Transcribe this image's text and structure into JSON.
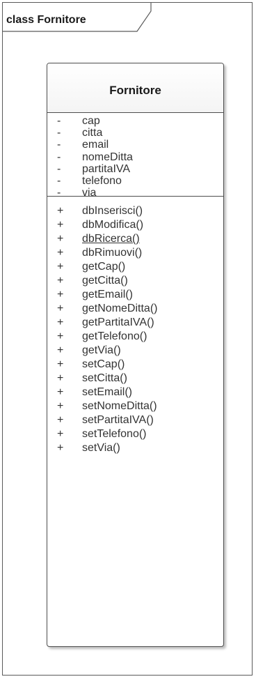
{
  "frame": {
    "title": "class Fornitore"
  },
  "class": {
    "name": "Fornitore",
    "attributes": [
      {
        "visibility": "-",
        "name": "cap"
      },
      {
        "visibility": "-",
        "name": "citta"
      },
      {
        "visibility": "-",
        "name": "email"
      },
      {
        "visibility": "-",
        "name": "nomeDitta"
      },
      {
        "visibility": "-",
        "name": "partitaIVA"
      },
      {
        "visibility": "-",
        "name": "telefono"
      },
      {
        "visibility": "-",
        "name": "via"
      }
    ],
    "operations": [
      {
        "visibility": "+",
        "name": "dbInserisci()",
        "static": false
      },
      {
        "visibility": "+",
        "name": "dbModifica()",
        "static": false
      },
      {
        "visibility": "+",
        "name": "dbRicerca()",
        "static": true
      },
      {
        "visibility": "+",
        "name": "dbRimuovi()",
        "static": false
      },
      {
        "visibility": "+",
        "name": "getCap()",
        "static": false
      },
      {
        "visibility": "+",
        "name": "getCitta()",
        "static": false
      },
      {
        "visibility": "+",
        "name": "getEmail()",
        "static": false
      },
      {
        "visibility": "+",
        "name": "getNomeDitta()",
        "static": false
      },
      {
        "visibility": "+",
        "name": "getPartitaIVA()",
        "static": false
      },
      {
        "visibility": "+",
        "name": "getTelefono()",
        "static": false
      },
      {
        "visibility": "+",
        "name": "getVia()",
        "static": false
      },
      {
        "visibility": "+",
        "name": "setCap()",
        "static": false
      },
      {
        "visibility": "+",
        "name": "setCitta()",
        "static": false
      },
      {
        "visibility": "+",
        "name": "setEmail()",
        "static": false
      },
      {
        "visibility": "+",
        "name": "setNomeDitta()",
        "static": false
      },
      {
        "visibility": "+",
        "name": "setPartitaIVA()",
        "static": false
      },
      {
        "visibility": "+",
        "name": "setTelefono()",
        "static": false
      },
      {
        "visibility": "+",
        "name": "setVia()",
        "static": false
      }
    ]
  }
}
